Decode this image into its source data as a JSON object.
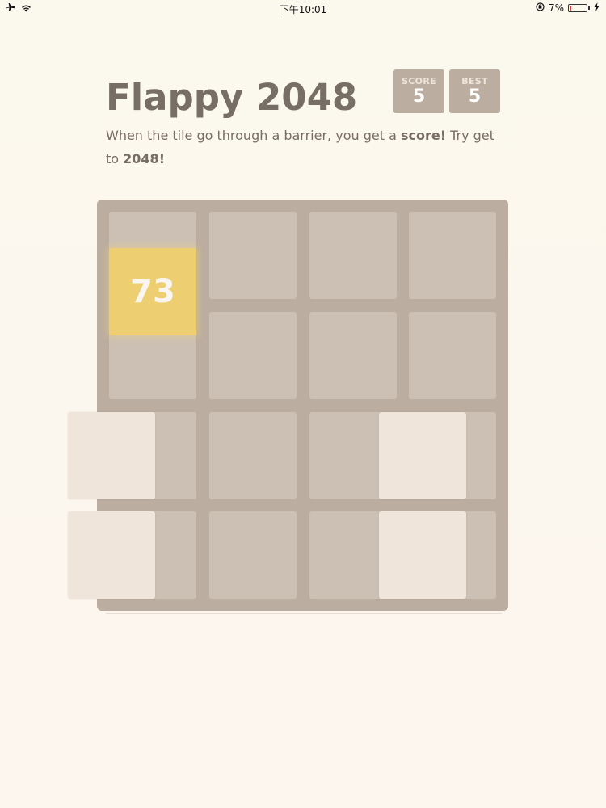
{
  "status_bar": {
    "time": "下午10:01",
    "battery_percent": "7%",
    "battery_level": 0.07
  },
  "header": {
    "title": "Flappy 2048",
    "score_label": "SCORE",
    "score_value": "5",
    "best_label": "BEST",
    "best_value": "5"
  },
  "intro": {
    "part1": "When the tile go through a barrier, you get a ",
    "bold1": "score!",
    "part2": " Try get to ",
    "bold2": "2048!"
  },
  "board": {
    "rows": 4,
    "cols": 4,
    "tile": {
      "value": "73",
      "color": "#edcf72"
    },
    "barrier_color": "#efe5da",
    "background_color": "#bbada0"
  }
}
